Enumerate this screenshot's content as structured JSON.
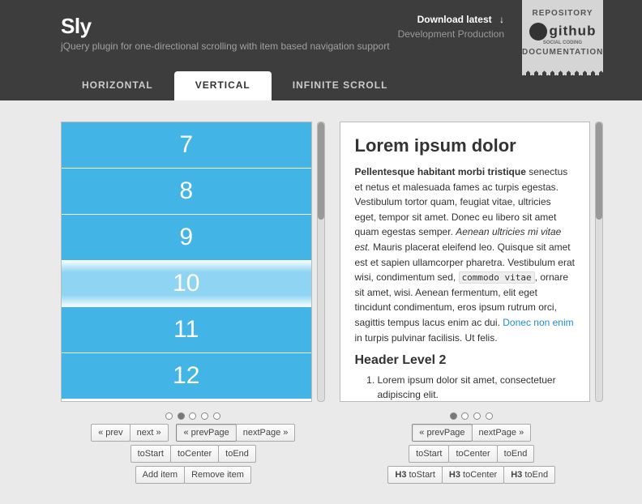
{
  "header": {
    "title": "Sly",
    "subtitle": "jQuery plugin for one-directional scrolling with item based navigation support",
    "download": {
      "label": "Download latest",
      "arrow": "↓"
    },
    "dev_prod": "Development Production"
  },
  "ribbon": {
    "repo": "REPOSITORY",
    "github": "github",
    "ghsub": "SOCIAL CODING",
    "docs": "DOCUMENTATION"
  },
  "tabs": [
    {
      "label": "HORIZONTAL",
      "active": false
    },
    {
      "label": "VERTICAL",
      "active": true
    },
    {
      "label": "INFINITE SCROLL",
      "active": false
    }
  ],
  "left": {
    "items": [
      {
        "n": "7",
        "active": false
      },
      {
        "n": "8",
        "active": false
      },
      {
        "n": "9",
        "active": false
      },
      {
        "n": "10",
        "active": true
      },
      {
        "n": "11",
        "active": false
      },
      {
        "n": "12",
        "active": false
      }
    ],
    "pages": {
      "count": 5,
      "active": 1
    },
    "row1": {
      "prev": "« prev",
      "next": "next »",
      "prevPage": "« prevPage",
      "nextPage": "nextPage »"
    },
    "row2": {
      "toStart": "toStart",
      "toCenter": "toCenter",
      "toEnd": "toEnd"
    },
    "row3": {
      "add": "Add item",
      "remove": "Remove item"
    }
  },
  "right": {
    "h1": "Lorem ipsum dolor",
    "p_strong": "Pellentesque habitant morbi tristique",
    "p_text1": " senectus et netus et malesuada fames ac turpis egestas. Vestibulum tortor quam, feugiat vitae, ultricies eget, tempor sit amet. Donec eu libero sit amet quam egestas semper. ",
    "p_em": "Aenean ultricies mi vitae est.",
    "p_text2": " Mauris placerat eleifend leo. Quisque sit amet est et sapien ullamcorper pharetra. Vestibulum erat wisi, condimentum sed, ",
    "p_code": "commodo vitae",
    "p_text3": ", ornare sit amet, wisi. Aenean fermentum, elit eget tincidunt condimentum, eros ipsum rutrum orci, sagittis tempus lacus enim ac dui. ",
    "p_link": "Donec non enim",
    "p_text4": " in turpis pulvinar facilisis. Ut felis.",
    "h2": "Header Level 2",
    "li1": "Lorem ipsum dolor sit amet, consectetuer adipiscing elit.",
    "pages": {
      "count": 4,
      "active": 0
    },
    "row1": {
      "prevPage": "« prevPage",
      "nextPage": "nextPage »"
    },
    "row2": {
      "toStart": "toStart",
      "toCenter": "toCenter",
      "toEnd": "toEnd"
    },
    "row3": {
      "h3a": "H3",
      "a": "toStart",
      "h3b": "H3",
      "b": "toCenter",
      "h3c": "H3",
      "c": "toEnd"
    }
  }
}
